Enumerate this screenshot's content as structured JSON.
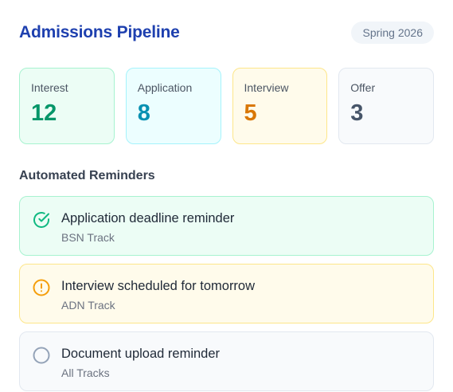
{
  "header": {
    "title": "Admissions Pipeline",
    "term_badge": "Spring 2026"
  },
  "colors": {
    "title": "#1e40af",
    "interest": "#059669",
    "application": "#0891b2",
    "interview": "#d97706",
    "offer": "#475569"
  },
  "stats": [
    {
      "label": "Interest",
      "value": "12"
    },
    {
      "label": "Application",
      "value": "8"
    },
    {
      "label": "Interview",
      "value": "5"
    },
    {
      "label": "Offer",
      "value": "3"
    }
  ],
  "reminders_section": {
    "title": "Automated Reminders",
    "items": [
      {
        "title": "Application deadline reminder",
        "track": "BSN Track",
        "icon": "check-circle-icon",
        "status": "done"
      },
      {
        "title": "Interview scheduled for tomorrow",
        "track": "ADN Track",
        "icon": "alert-circle-icon",
        "status": "warning"
      },
      {
        "title": "Document upload reminder",
        "track": "All Tracks",
        "icon": "empty-circle-icon",
        "status": "pending"
      }
    ]
  }
}
